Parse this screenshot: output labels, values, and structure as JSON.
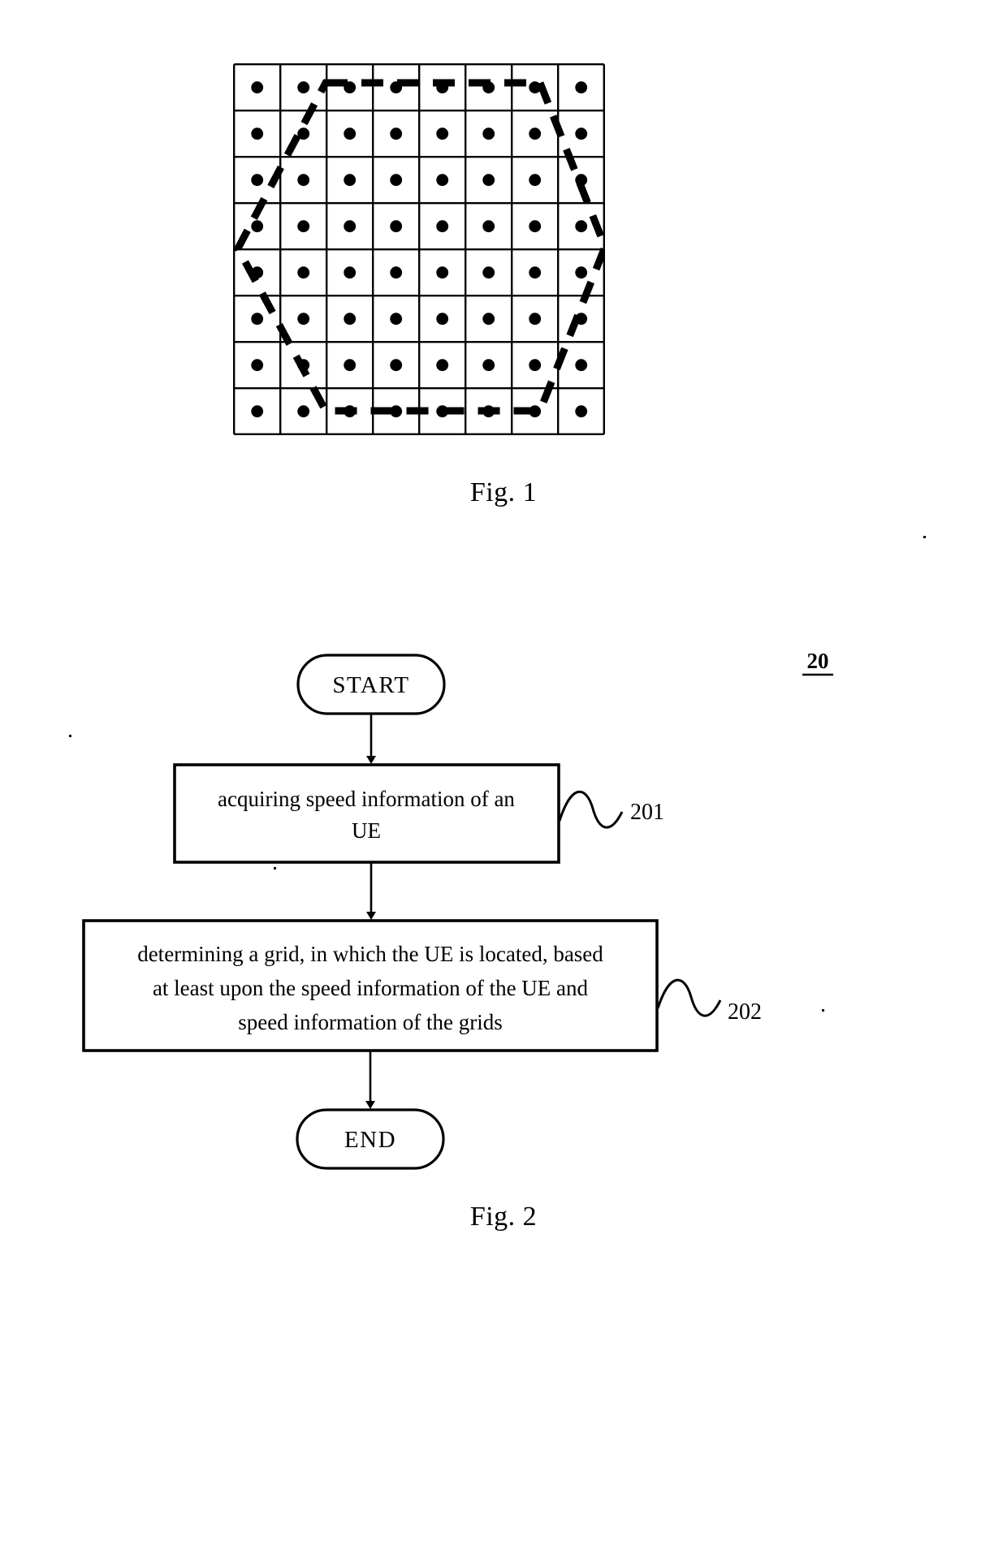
{
  "page": {
    "background_color": "#ffffff",
    "ink_color": "#000000"
  },
  "figure1": {
    "caption": "Fig. 1",
    "grid": {
      "rows": 8,
      "cols": 8,
      "cell_marker": "dot",
      "dot_count": 64,
      "overlay_shape": "hexagon",
      "overlay_style": "dashed",
      "description": "8 by 8 square grid of cells, each containing a centred black dot, with a dashed hexagon outline overlaid on the grid"
    }
  },
  "figure2": {
    "caption": "Fig. 2",
    "diagram_ref": "20",
    "nodes": [
      {
        "id": "start",
        "type": "terminal",
        "label": "START"
      },
      {
        "id": "step201",
        "type": "process",
        "ref": "201",
        "lines": [
          "acquiring speed information of an",
          "UE"
        ]
      },
      {
        "id": "step202",
        "type": "process",
        "ref": "202",
        "lines": [
          "determining a grid, in which the UE is located, based",
          "at least upon the speed information of the UE and",
          "speed information of the grids"
        ]
      },
      {
        "id": "end",
        "type": "terminal",
        "label": "END"
      }
    ]
  },
  "chart_data": {
    "type": "scatter",
    "title": "Fig. 1",
    "xlabel": "",
    "ylabel": "",
    "xlim": [
      0,
      8
    ],
    "ylim": [
      0,
      8
    ],
    "grid": true,
    "legend": null,
    "series": [
      {
        "name": "grid cell centres",
        "marker": "filled-circle",
        "x": [
          0.5,
          1.5,
          2.5,
          3.5,
          4.5,
          5.5,
          6.5,
          7.5,
          0.5,
          1.5,
          2.5,
          3.5,
          4.5,
          5.5,
          6.5,
          7.5,
          0.5,
          1.5,
          2.5,
          3.5,
          4.5,
          5.5,
          6.5,
          7.5,
          0.5,
          1.5,
          2.5,
          3.5,
          4.5,
          5.5,
          6.5,
          7.5,
          0.5,
          1.5,
          2.5,
          3.5,
          4.5,
          5.5,
          6.5,
          7.5,
          0.5,
          1.5,
          2.5,
          3.5,
          4.5,
          5.5,
          6.5,
          7.5,
          0.5,
          1.5,
          2.5,
          3.5,
          4.5,
          5.5,
          6.5,
          7.5,
          0.5,
          1.5,
          2.5,
          3.5,
          4.5,
          5.5,
          6.5,
          7.5
        ],
        "y": [
          7.5,
          7.5,
          7.5,
          7.5,
          7.5,
          7.5,
          7.5,
          7.5,
          6.5,
          6.5,
          6.5,
          6.5,
          6.5,
          6.5,
          6.5,
          6.5,
          5.5,
          5.5,
          5.5,
          5.5,
          5.5,
          5.5,
          5.5,
          5.5,
          4.5,
          4.5,
          4.5,
          4.5,
          4.5,
          4.5,
          4.5,
          4.5,
          3.5,
          3.5,
          3.5,
          3.5,
          3.5,
          3.5,
          3.5,
          3.5,
          2.5,
          2.5,
          2.5,
          2.5,
          2.5,
          2.5,
          2.5,
          2.5,
          1.5,
          1.5,
          1.5,
          1.5,
          1.5,
          1.5,
          1.5,
          1.5,
          0.5,
          0.5,
          0.5,
          0.5,
          0.5,
          0.5,
          0.5,
          0.5
        ]
      }
    ],
    "annotations": [
      {
        "name": "dashed-hexagon",
        "style": "dashed",
        "vertices": [
          [
            2.0,
            7.8
          ],
          [
            6.6,
            7.8
          ],
          [
            8.0,
            4.2
          ],
          [
            6.6,
            0.4
          ],
          [
            2.0,
            0.4
          ],
          [
            0.1,
            4.3
          ]
        ]
      }
    ]
  }
}
